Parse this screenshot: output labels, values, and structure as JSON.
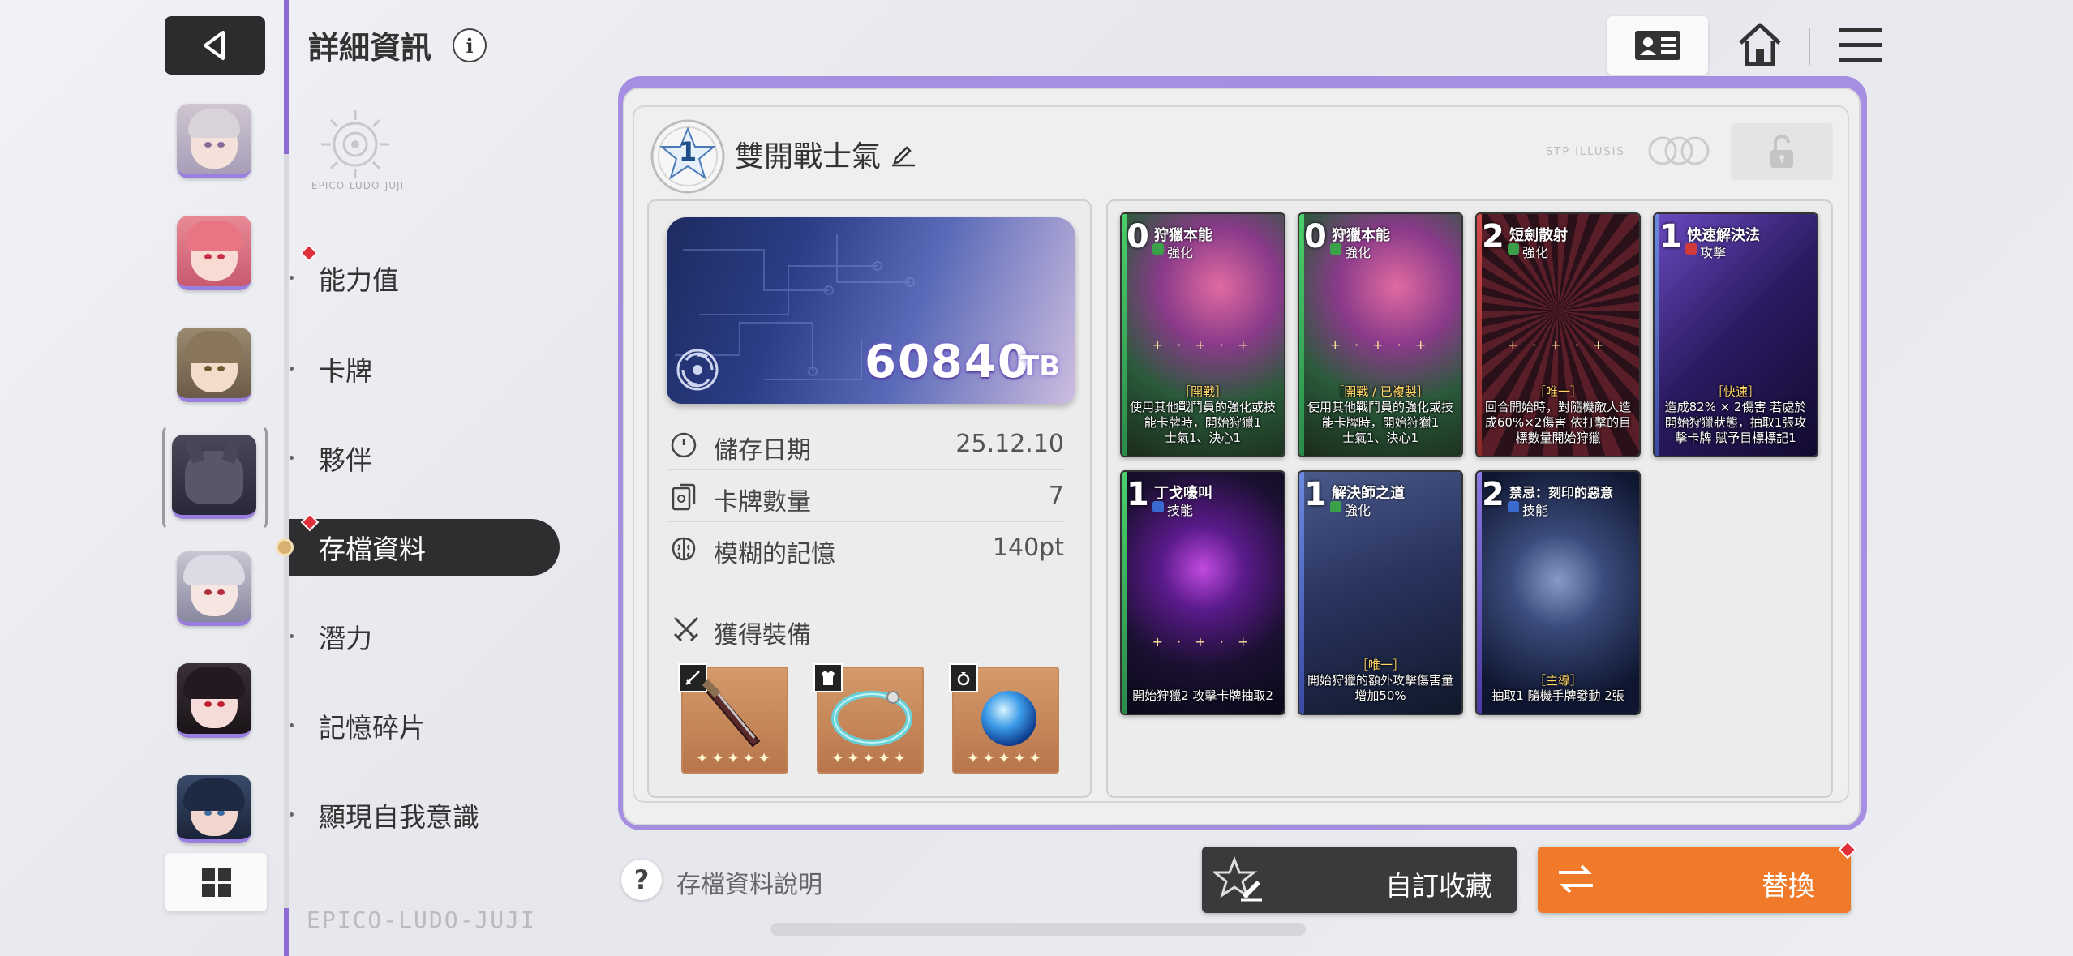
{
  "header": {
    "title": "詳細資訊",
    "info_icon": "i"
  },
  "emblem_text": "EPICO-LUDO-JUJI",
  "footer_emblem": "EPICO-LUDO-JUJI",
  "menu": {
    "items": [
      {
        "label": "能力值",
        "badge": true
      },
      {
        "label": "卡牌",
        "badge": false
      },
      {
        "label": "夥伴",
        "badge": false
      },
      {
        "label": "存檔資料",
        "badge": true,
        "active": true
      },
      {
        "label": "潛力",
        "badge": false
      },
      {
        "label": "記憶碎片",
        "badge": false
      },
      {
        "label": "顯現自我意識",
        "badge": false
      }
    ]
  },
  "save": {
    "rank": "1",
    "name": "雙開戰士氣",
    "faint_text": "STP ILLUSIS",
    "tb_value": "60840",
    "tb_unit": "TB",
    "info": [
      {
        "key": "儲存日期",
        "value": "25.12.10",
        "icon": "clock-icon"
      },
      {
        "key": "卡牌數量",
        "value": "7",
        "icon": "cards-icon"
      },
      {
        "key": "模糊的記憶",
        "value": "140pt",
        "icon": "brain-icon"
      }
    ],
    "equip_title": "獲得裝備",
    "equipment": [
      {
        "name": "dagger",
        "type_icon": "sword-icon",
        "stars": "✦✦✦✦✦"
      },
      {
        "name": "ring",
        "type_icon": "armor-icon",
        "stars": "✦✦✦✦✦"
      },
      {
        "name": "orb",
        "type_icon": "ring-icon",
        "stars": "✦✦✦✦✦"
      }
    ]
  },
  "cards": [
    {
      "cost": "0",
      "name": "狩獵本能",
      "type": "強化",
      "sparkle": "+ · + · +",
      "desc_kw": "［開戰］",
      "desc": "使用其他戰鬥員的強化或技能卡牌時，開始狩獵1",
      "foot": "士氣1、決心1",
      "colors": [
        "#7b3a8a",
        "#2a5e3a",
        "#c43c6a"
      ]
    },
    {
      "cost": "0",
      "name": "狩獵本能",
      "type": "強化",
      "sparkle": "+ · + · +",
      "desc_kw": "［開戰 / 已複製］",
      "desc": "使用其他戰鬥員的強化或技能卡牌時，開始狩獵1",
      "foot": "士氣1、決心1",
      "colors": [
        "#7b3a8a",
        "#2a5e3a",
        "#c43c6a"
      ]
    },
    {
      "cost": "2",
      "name": "短劍散射",
      "type": "強化",
      "sparkle": "+ · + · +",
      "desc_kw": "［唯一］",
      "desc": "回合開始時，對隨機敵人造成60%×2傷害 依打擊的目標數量開始狩獵",
      "foot": "",
      "colors": [
        "#3a2230",
        "#8a3030",
        "#1e1e28"
      ]
    },
    {
      "cost": "1",
      "name": "快速解決法",
      "type": "攻擊",
      "sparkle": "",
      "desc_kw": "［快速］",
      "desc": "造成82% × 2傷害 若處於開始狩獵狀態，抽取1張攻擊卡牌 賦予目標標記1",
      "foot": "",
      "colors": [
        "#3a2a7a",
        "#6a4ac0",
        "#1a1440"
      ]
    },
    {
      "cost": "1",
      "name": "丁戈嚎叫",
      "type": "技能",
      "sparkle": "+ · + · +",
      "desc_kw": "",
      "desc": "開始狩獵2 攻擊卡牌抽取2",
      "foot": "",
      "colors": [
        "#1a1030",
        "#8a2ab0",
        "#2a2a4a"
      ]
    },
    {
      "cost": "1",
      "name": "解決師之道",
      "type": "強化",
      "sparkle": "",
      "desc_kw": "［唯一］",
      "desc": "開始狩獵的額外攻擊傷害量增加50%",
      "foot": "",
      "colors": [
        "#1e2a4a",
        "#3a4a7a",
        "#10182a"
      ]
    },
    {
      "cost": "2",
      "name": "禁忌：刻印的惡意",
      "type": "技能",
      "sparkle": "",
      "desc_kw": "［主導］",
      "desc": "抽取1 隨機手牌發動 2張",
      "foot": "",
      "colors": [
        "#1a2a4a",
        "#4a5a8a",
        "#0e1630"
      ]
    }
  ],
  "bottom": {
    "help_label": "存檔資料說明",
    "custom_label": "自訂收藏",
    "swap_label": "替換"
  },
  "colors": {
    "accent": "#9a7ee0",
    "swap": "#f07a2a",
    "dark": "#2e2e30",
    "badge": "#e0303a"
  }
}
